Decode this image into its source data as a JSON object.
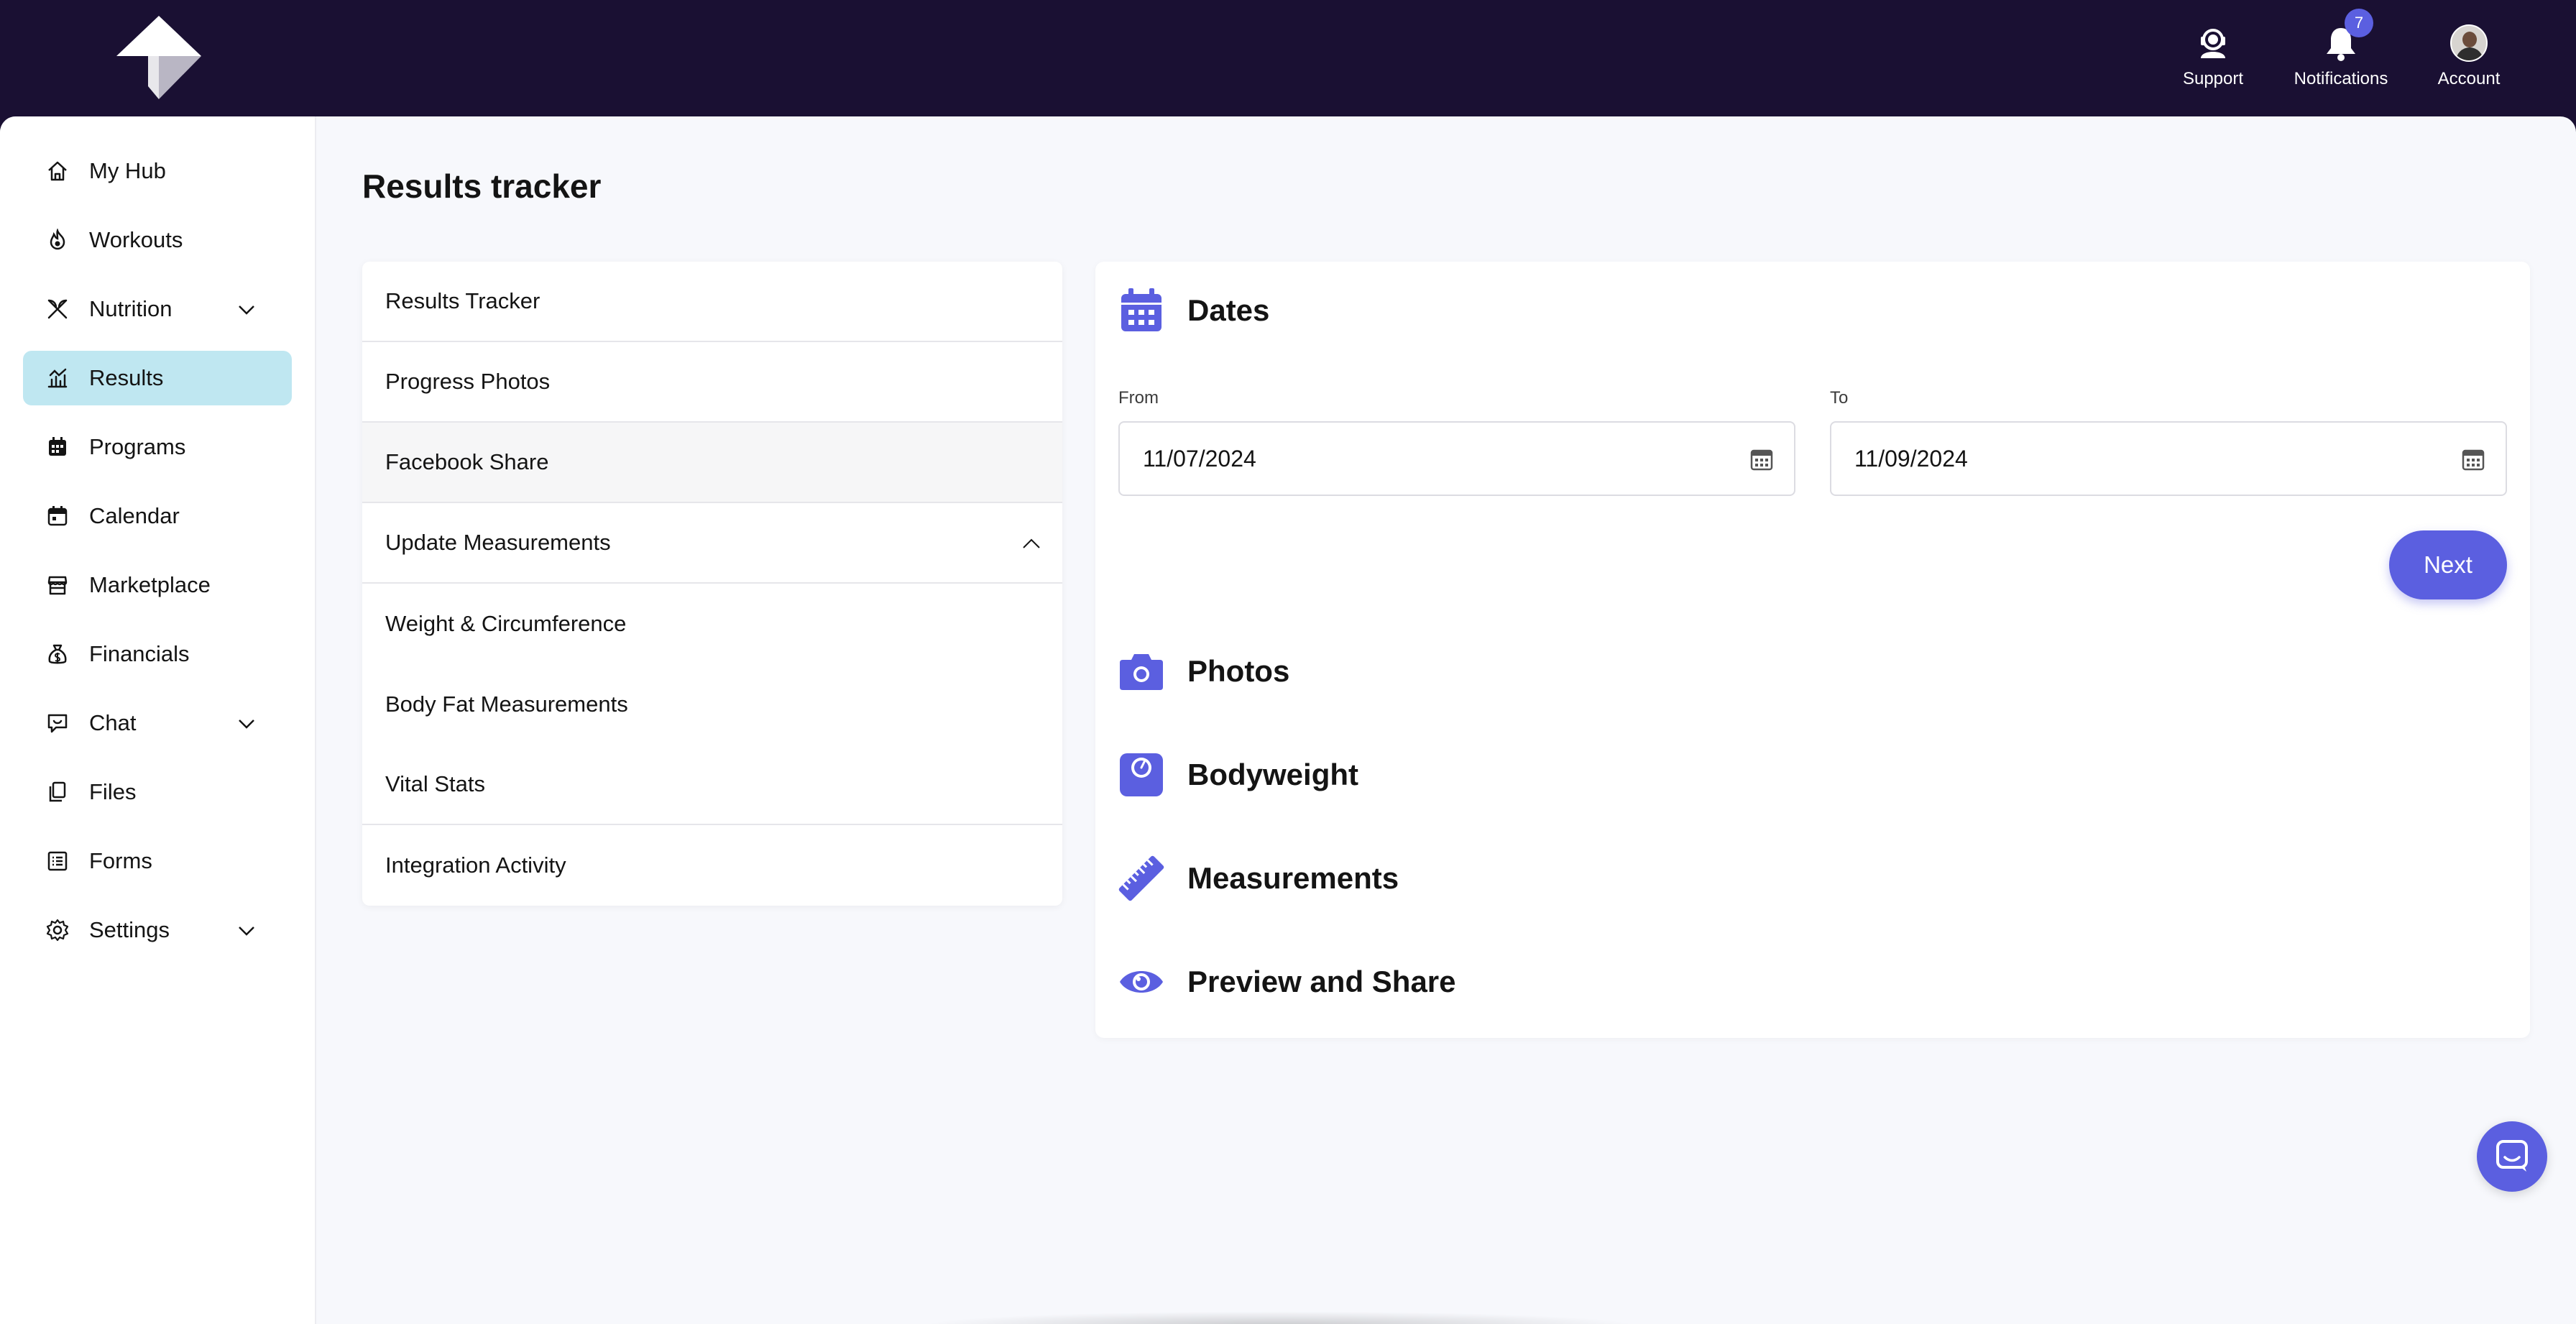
{
  "header": {
    "support_label": "Support",
    "notifications_label": "Notifications",
    "notifications_count": "7",
    "account_label": "Account"
  },
  "sidebar": {
    "items": [
      {
        "label": "My Hub",
        "icon": "home-icon"
      },
      {
        "label": "Workouts",
        "icon": "flame-icon"
      },
      {
        "label": "Nutrition",
        "icon": "utensils-icon",
        "expandable": true
      },
      {
        "label": "Results",
        "icon": "chart-icon",
        "active": true
      },
      {
        "label": "Programs",
        "icon": "calendar-grid-icon"
      },
      {
        "label": "Calendar",
        "icon": "calendar-icon"
      },
      {
        "label": "Marketplace",
        "icon": "store-icon"
      },
      {
        "label": "Financials",
        "icon": "money-bag-icon"
      },
      {
        "label": "Chat",
        "icon": "chat-icon",
        "expandable": true
      },
      {
        "label": "Files",
        "icon": "files-icon"
      },
      {
        "label": "Forms",
        "icon": "form-icon"
      },
      {
        "label": "Settings",
        "icon": "gear-icon",
        "expandable": true
      }
    ]
  },
  "main": {
    "page_title": "Results tracker",
    "menu": [
      {
        "label": "Results Tracker"
      },
      {
        "label": "Progress Photos"
      },
      {
        "label": "Facebook Share"
      },
      {
        "label": "Update Measurements"
      },
      {
        "label": "Weight & Circumference"
      },
      {
        "label": "Body Fat Measurements"
      },
      {
        "label": "Vital Stats"
      },
      {
        "label": "Integration Activity"
      }
    ],
    "wizard": {
      "dates_title": "Dates",
      "from_label": "From",
      "from_value": "11/07/2024",
      "to_label": "To",
      "to_value": "11/09/2024",
      "next_label": "Next",
      "photos_title": "Photos",
      "bodyweight_title": "Bodyweight",
      "measurements_title": "Measurements",
      "preview_title": "Preview and Share"
    }
  },
  "colors": {
    "topbar": "#1a1033",
    "accent": "#5b5fe0",
    "active_nav": "#bfe7f1"
  }
}
